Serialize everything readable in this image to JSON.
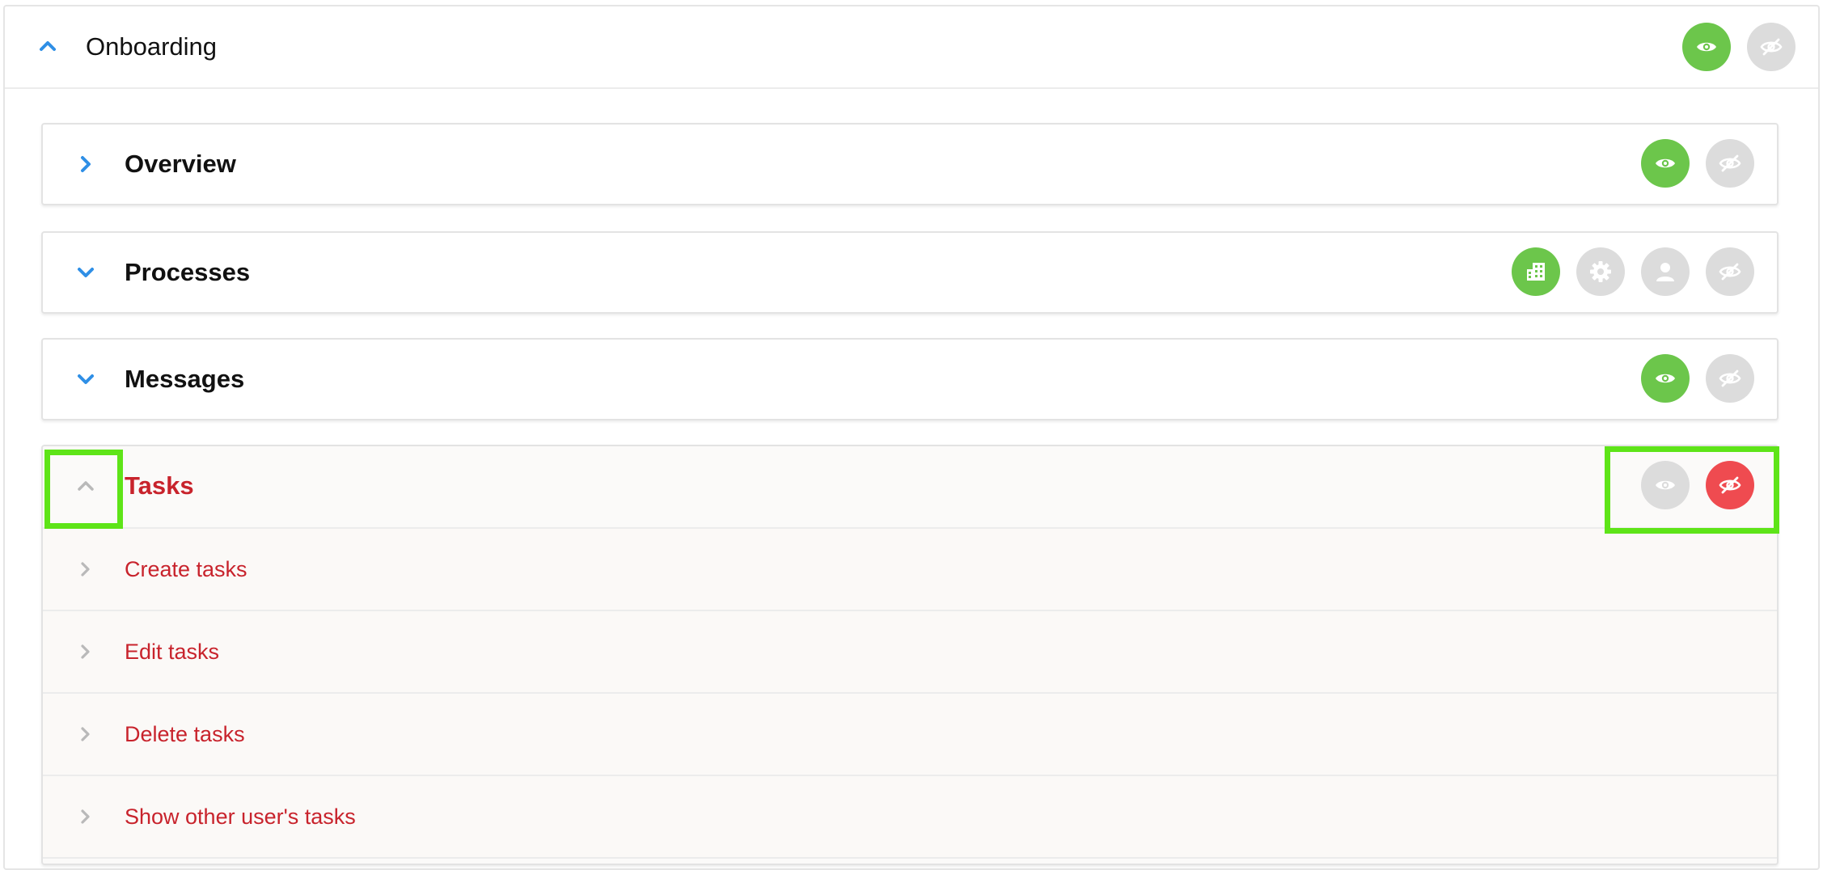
{
  "onboarding": {
    "title": "Onboarding",
    "expanded": true,
    "actions": [
      {
        "icon": "eye-icon",
        "state": "active",
        "color": "#6cc64b"
      },
      {
        "icon": "eye-slash-icon",
        "state": "inactive",
        "color": "#dcdcdc"
      }
    ]
  },
  "sections": {
    "overview": {
      "title": "Overview",
      "expanded": false,
      "actions": [
        {
          "icon": "eye-icon",
          "state": "active"
        },
        {
          "icon": "eye-slash-icon",
          "state": "inactive"
        }
      ]
    },
    "processes": {
      "title": "Processes",
      "expanded": false,
      "actions": [
        {
          "icon": "building-icon",
          "state": "active"
        },
        {
          "icon": "gear-icon",
          "state": "inactive"
        },
        {
          "icon": "user-icon",
          "state": "inactive"
        },
        {
          "icon": "eye-slash-icon",
          "state": "inactive"
        }
      ]
    },
    "messages": {
      "title": "Messages",
      "expanded": false,
      "actions": [
        {
          "icon": "eye-icon",
          "state": "active"
        },
        {
          "icon": "eye-slash-icon",
          "state": "inactive"
        }
      ]
    },
    "tasks": {
      "title": "Tasks",
      "expanded": true,
      "title_color": "#c8232c",
      "actions": [
        {
          "icon": "eye-icon",
          "state": "inactive"
        },
        {
          "icon": "eye-slash-icon",
          "state": "active",
          "color": "#ef4b50"
        }
      ],
      "items": [
        {
          "label": "Create tasks"
        },
        {
          "label": "Edit tasks"
        },
        {
          "label": "Delete tasks"
        },
        {
          "label": "Show other user's tasks"
        }
      ]
    }
  },
  "colors": {
    "accent_blue": "#2f8fe6",
    "active_green": "#6cc64b",
    "inactive_grey": "#dcdcdc",
    "denied_red": "#ef4b50",
    "highlight_green": "#5ee418"
  }
}
